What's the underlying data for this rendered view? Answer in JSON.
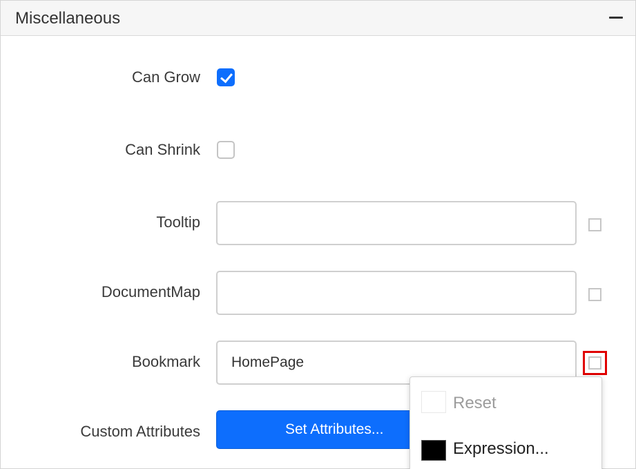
{
  "panel": {
    "title": "Miscellaneous"
  },
  "properties": {
    "can_grow": {
      "label": "Can Grow",
      "checked": true
    },
    "can_shrink": {
      "label": "Can Shrink",
      "checked": false
    },
    "tooltip": {
      "label": "Tooltip",
      "value": ""
    },
    "document_map": {
      "label": "DocumentMap",
      "value": ""
    },
    "bookmark": {
      "label": "Bookmark",
      "value": "HomePage"
    },
    "custom_attributes": {
      "label": "Custom Attributes",
      "button_label": "Set Attributes..."
    }
  },
  "context_menu": {
    "items": [
      {
        "label": "Reset",
        "enabled": false,
        "swatch_color": "#ffffff"
      },
      {
        "label": "Expression...",
        "enabled": true,
        "swatch_color": "#000000"
      }
    ]
  },
  "colors": {
    "accent": "#0d6efd",
    "highlight": "#e00000"
  }
}
